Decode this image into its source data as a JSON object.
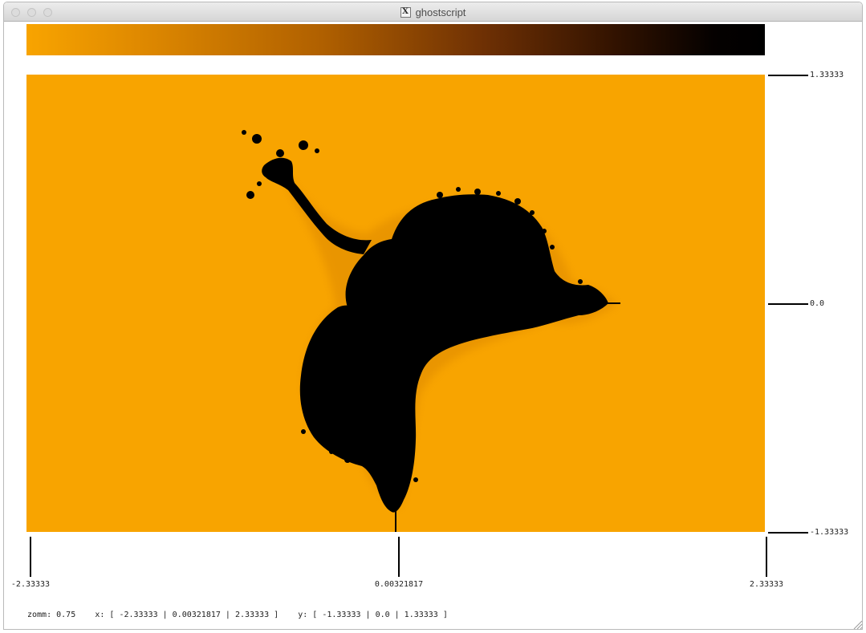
{
  "window": {
    "title": "ghostscript",
    "title_icon": "x11-icon",
    "title_icon_glyph": "X"
  },
  "colorbar": {
    "start_color": "#f8a400",
    "end_color": "#000000"
  },
  "plot": {
    "background_color": "#f8a400",
    "set_color": "#000000"
  },
  "axes": {
    "y_ticks": [
      "1.33333",
      "0.0",
      "-1.33333"
    ],
    "x_ticks": [
      "-2.33333",
      "0.00321817",
      "2.33333"
    ]
  },
  "status": {
    "zoom_label": "zomm:",
    "zoom_value": "0.75",
    "x_label": "x:",
    "x_range": "[ -2.33333 | 0.00321817 | 2.33333 ]",
    "y_label": "y:",
    "y_range": "[ -1.33333 | 0.0 | 1.33333 ]"
  }
}
